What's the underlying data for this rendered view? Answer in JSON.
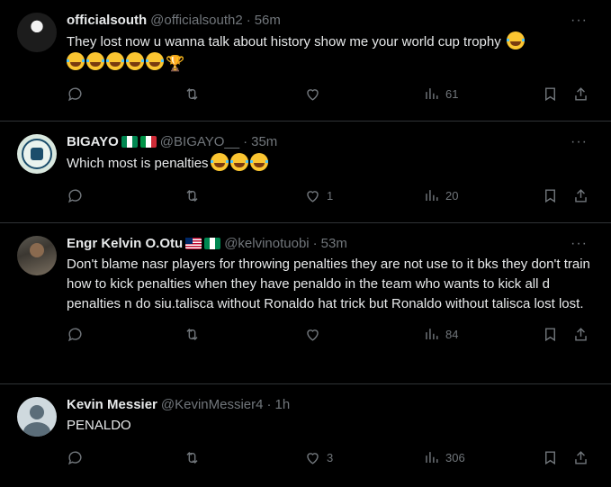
{
  "tweets": [
    {
      "name": "officialsouth",
      "handle": "@officialsouth2",
      "time": "56m",
      "text": "They lost now u wanna talk about history  show me your world cup trophy",
      "likes": "",
      "views": "61",
      "flags": [],
      "avatar": "av1"
    },
    {
      "name": "BIGAYO",
      "handle": "@BIGAYO__",
      "time": "35m",
      "text": "Which most is penalties",
      "likes": "1",
      "views": "20",
      "flags": [
        "flag-ng",
        "flag-it"
      ],
      "avatar": "av2"
    },
    {
      "name": "Engr Kelvin O.Otu",
      "handle": "@kelvinotuobi",
      "time": "53m",
      "text": "Don't blame nasr players for throwing penalties they are not use to it bks they don't train how to kick penalties when they have penaldo in the team who wants to kick all d penalties n do siu.talisca without Ronaldo hat trick but Ronaldo without talisca lost lost.",
      "likes": "",
      "views": "84",
      "flags": [
        "flag-lr",
        "flag-ng"
      ],
      "avatar": "av3"
    },
    {
      "name": "Kevin Messier",
      "handle": "@KevinMessier4",
      "time": "1h",
      "text": "PENALDO",
      "likes": "3",
      "views": "306",
      "flags": [],
      "avatar": "av4"
    }
  ],
  "sep": "·",
  "more": "···",
  "trophy": "🏆"
}
